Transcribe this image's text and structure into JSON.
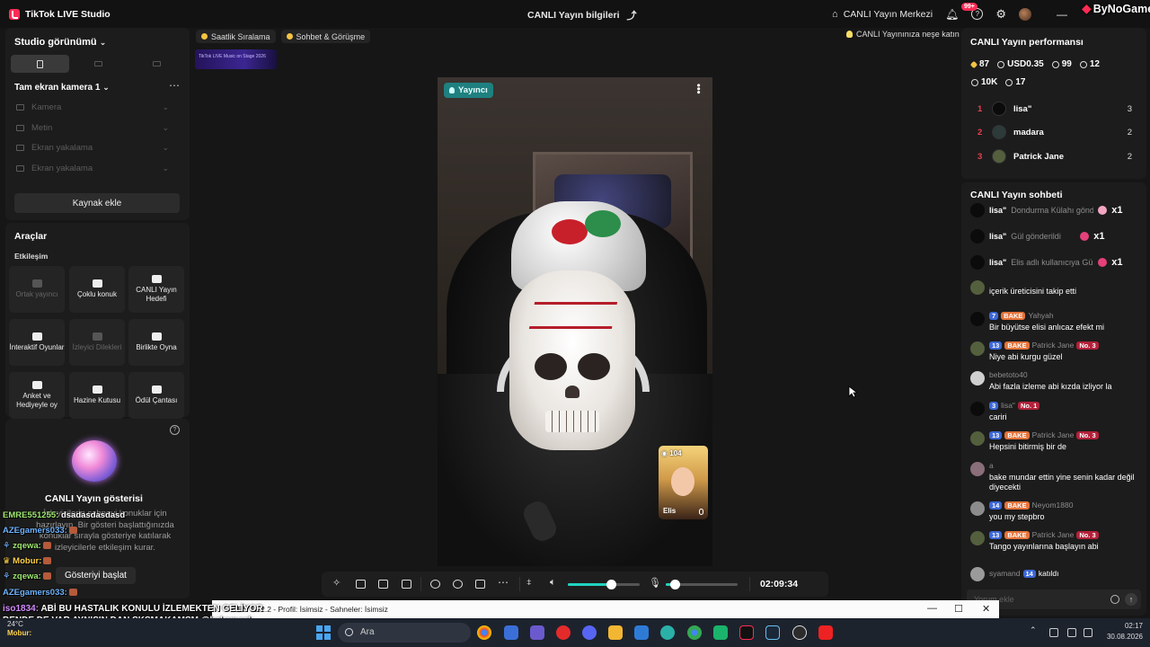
{
  "titlebar": {
    "app_name": "TikTok LIVE Studio",
    "center_title": "CANLI Yayın bilgileri",
    "live_center": "CANLI Yayın Merkezi",
    "notif_badge": "99+",
    "watermark": "ByNoGame"
  },
  "left": {
    "studio_view": "Studio görünümü",
    "scene_name": "Tam ekran kamera 1",
    "sources": [
      "Kamera",
      "Metin",
      "Ekran yakalama",
      "Ekran yakalama"
    ],
    "add_source": "Kaynak ekle",
    "tools_title": "Araçlar",
    "tools_section": "Etkileşim",
    "tools": [
      {
        "label": "Ortak yayıncı",
        "enabled": false
      },
      {
        "label": "Çoklu konuk",
        "enabled": true
      },
      {
        "label": "CANLI Yayın Hedefi",
        "enabled": true
      },
      {
        "label": "İnteraktif Oyunlar",
        "enabled": true
      },
      {
        "label": "İzleyici Dilekleri",
        "enabled": false
      },
      {
        "label": "Birlikte Oyna",
        "enabled": true
      },
      {
        "label": "Anket ve Hediyeyle oy",
        "enabled": true
      },
      {
        "label": "Hazine Kutusu",
        "enabled": true
      },
      {
        "label": "Ödül Çantası",
        "enabled": true
      }
    ],
    "show_title": "CANLI Yayın gösterisi",
    "show_desc": "İzleyicilerin sahneyi konuklar için hazırlayın. Bir gösteri başlattığınızda konuklar sırayla gösteriye katılarak izleyicilerle etkileşim kurar.",
    "show_tooltip": "Gösteriyi başlat"
  },
  "overlay_chat": [
    {
      "user": "EMRE551255:",
      "msg": "dsadasdasdasd"
    },
    {
      "user": "AZEgamers033:",
      "msg": ""
    },
    {
      "user": "zqewa:",
      "msg": ""
    },
    {
      "user": "Mobur:",
      "msg": ""
    },
    {
      "user": "zqewa:",
      "msg": ""
    },
    {
      "user": "AZEgamers033:",
      "msg": ""
    }
  ],
  "ticker": {
    "user": "iso1834:",
    "line1": "ABİ BU HASTALIK KONULU İZLEMEKTEN GELİYOR",
    "line2": "BENDE DE VAR AYNISIN DAN SKSMAKAMSM @bakemask",
    "line3": "Mobur:"
  },
  "center": {
    "chips": [
      "Saatlik Sıralama",
      "Sohbet & Görüşme"
    ],
    "chip_right": "CANLI Yayınınıza neşe katın",
    "banner": "TikTok LIVE Music on Stage 2026",
    "host_tag": "Yayıncı",
    "guest_count": "104",
    "guest_name": "Elis",
    "timer": "02:09:34",
    "volume_level": 0.6,
    "mic_level": 0.12
  },
  "right": {
    "perf_title": "CANLI Yayın performansı",
    "stats": [
      {
        "icon": "diamond-icon",
        "value": "87"
      },
      {
        "icon": "coin-icon",
        "value": "USD0.35"
      },
      {
        "icon": "viewers-icon",
        "value": "99"
      },
      {
        "icon": "share-icon",
        "value": "12"
      }
    ],
    "stats2": [
      {
        "icon": "heart-icon",
        "value": "10K"
      },
      {
        "icon": "gift-icon",
        "value": "17"
      }
    ],
    "ranking": [
      {
        "rank": "1",
        "name": "lisa\"",
        "value": "3"
      },
      {
        "rank": "2",
        "name": "madara",
        "value": "2"
      },
      {
        "rank": "3",
        "name": "Patrick Jane",
        "value": "2"
      }
    ],
    "chat_title": "CANLI Yayın sohbeti",
    "gifts": [
      {
        "user": "lisa\"",
        "text": "Dondurma Külahı gönd",
        "count": "x1"
      },
      {
        "user": "lisa\"",
        "text": "Gül gönderildi",
        "count": "x1"
      },
      {
        "user": "lisa\"",
        "text": "Elis adlı kullanıcıya Gü",
        "count": "x1"
      }
    ],
    "messages": [
      {
        "head": "",
        "lvl": "",
        "fan": "",
        "no": "",
        "text": "içerik üreticisini takip etti"
      },
      {
        "head": "Yahyah",
        "lvl": "7",
        "fan": "BAKE",
        "no": "",
        "text": "Bir büyütse elisi anlıcaz efekt mi"
      },
      {
        "head": "Patrick Jane",
        "lvl": "13",
        "fan": "BAKE",
        "no": "No. 3",
        "text": "Niye abi kurgu güzel"
      },
      {
        "head": "bebetoto40",
        "lvl": "",
        "fan": "",
        "no": "",
        "text": "Abi fazla izleme abi kızda izliyor la"
      },
      {
        "head": "lisa\"",
        "lvl": "3",
        "fan": "",
        "no": "No. 1",
        "text": "cariri"
      },
      {
        "head": "Patrick Jane",
        "lvl": "13",
        "fan": "BAKE",
        "no": "No. 3",
        "text": "Hepsini bitirmiş bir de"
      },
      {
        "head": "a",
        "lvl": "",
        "fan": "",
        "no": "",
        "text": "bake mundar ettin yine senin kadar değil diyecekti"
      },
      {
        "head": "Neyom1880",
        "lvl": "14",
        "fan": "BAKE",
        "no": "",
        "text": "you my stepbro"
      },
      {
        "head": "Patrick Jane",
        "lvl": "13",
        "fan": "BAKE",
        "no": "No. 3",
        "text": "Tango yayınlarına başlayın abi"
      },
      {
        "head": "syamand",
        "lvl": "14",
        "fan": "",
        "no": "",
        "text": "katıldı"
      }
    ],
    "chat_placeholder": "Yorum ekle"
  },
  "obs": {
    "title": "OBS 32.2.2 - Profil: İsimsiz - Sahneler: İsimsiz"
  },
  "taskbar": {
    "search": "Ara",
    "weather_temp": "24°C",
    "weather_desc": "Bulutlu",
    "time": "02:17",
    "date": "30.08.2026"
  }
}
